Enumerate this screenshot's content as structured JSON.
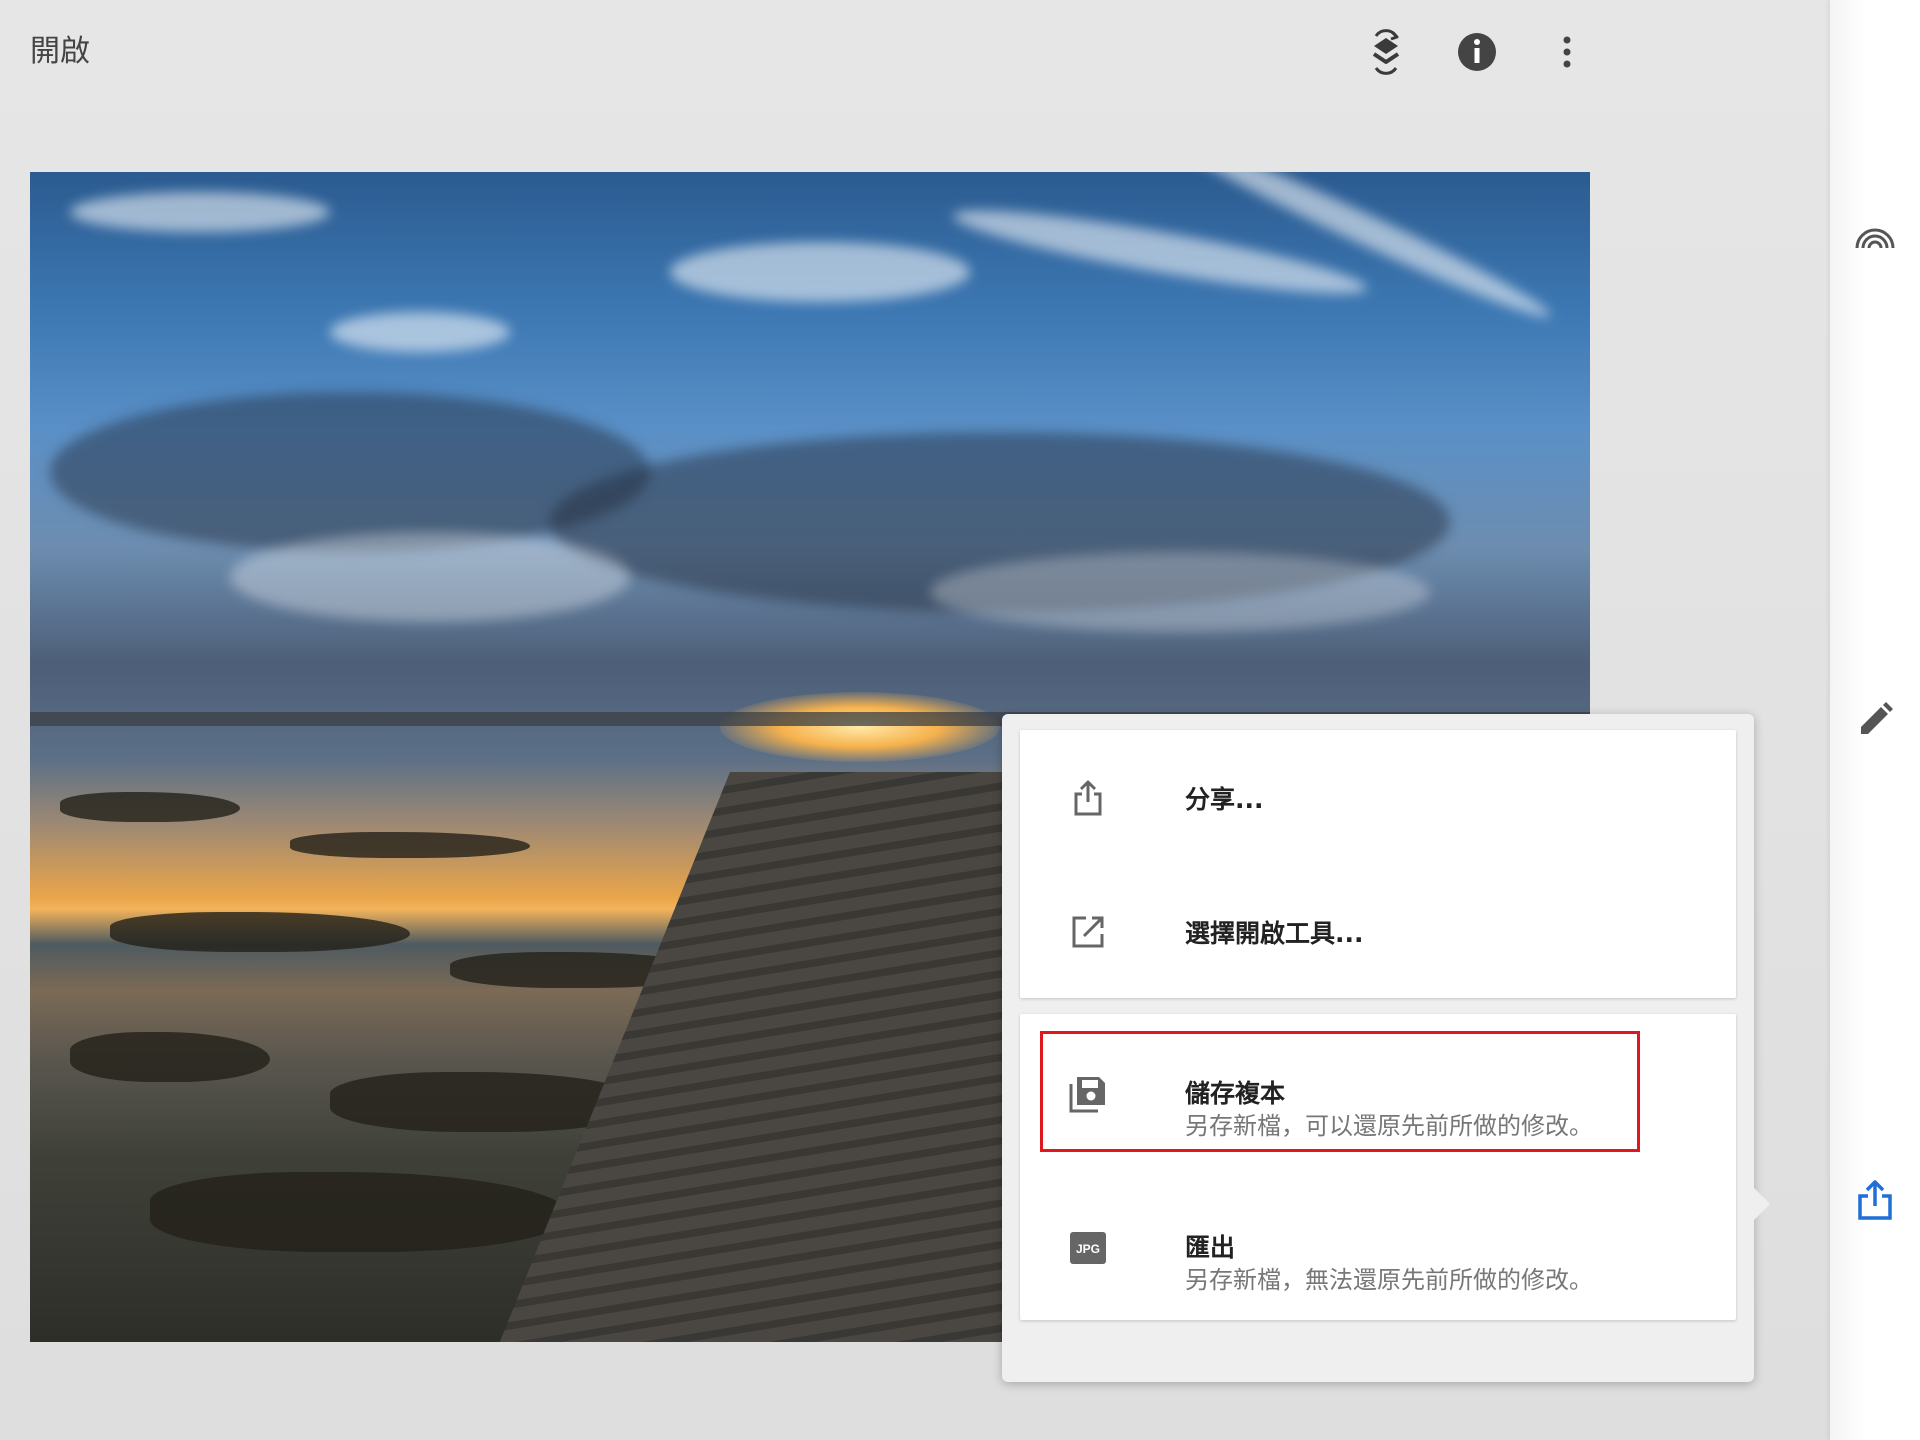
{
  "toolbar": {
    "open_label": "開啟",
    "icons": [
      "layers-swap-icon",
      "info-icon",
      "more-vert-icon"
    ]
  },
  "photo": {
    "description_icon": "photo-image"
  },
  "export_menu": {
    "items": [
      {
        "title": "分享...",
        "icon": "share-icon"
      },
      {
        "title": "選擇開啟工具...",
        "icon": "open-with-icon"
      },
      {
        "title": "儲存複本",
        "subtitle": "另存新檔，可以還原先前所做的修改。",
        "icon": "save-copy-icon",
        "highlighted": true
      },
      {
        "title": "匯出",
        "subtitle": "另存新檔，無法還原先前所做的修改。",
        "icon": "jpg-icon",
        "icon_text": "JPG"
      }
    ],
    "highlight_color": "#e0181e"
  },
  "right_rail": {
    "icons": [
      "looks-styles-icon",
      "edit-pencil-icon",
      "export-share-icon"
    ],
    "accent": "#1f6fd6"
  }
}
